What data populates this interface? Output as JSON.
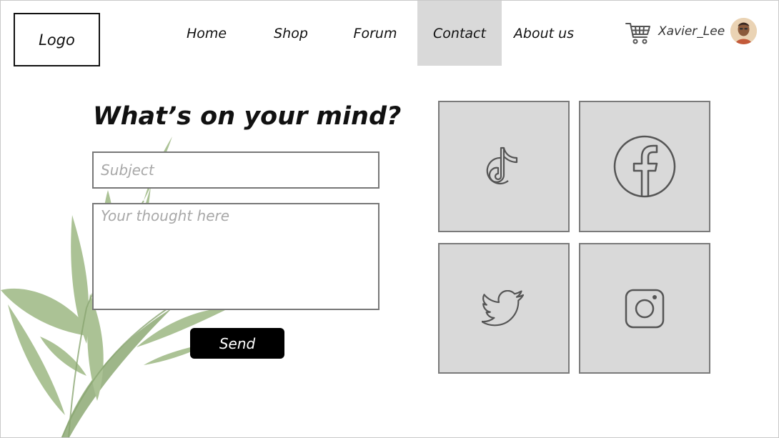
{
  "header": {
    "logo": "Logo",
    "nav": [
      {
        "label": "Home",
        "active": false
      },
      {
        "label": "Shop",
        "active": false
      },
      {
        "label": "Forum",
        "active": false
      },
      {
        "label": "Contact",
        "active": true
      },
      {
        "label": "About us",
        "active": false
      }
    ],
    "cart_icon": "shopping-cart-icon",
    "username": "Xavier_Lee",
    "avatar": "user-avatar"
  },
  "contact": {
    "heading": "What’s on your mind?",
    "subject_placeholder": "Subject",
    "thought_placeholder": "Your thought here",
    "send_label": "Send"
  },
  "social": [
    {
      "name": "TikTok",
      "icon": "tiktok-icon"
    },
    {
      "name": "Facebook",
      "icon": "facebook-icon"
    },
    {
      "name": "Twitter",
      "icon": "twitter-icon"
    },
    {
      "name": "Instagram",
      "icon": "instagram-icon"
    }
  ],
  "colors": {
    "active_tab": "#d9d9d9",
    "tile_bg": "#d9d9d9",
    "button_bg": "#000000",
    "leaf_green": "#8fae72"
  }
}
